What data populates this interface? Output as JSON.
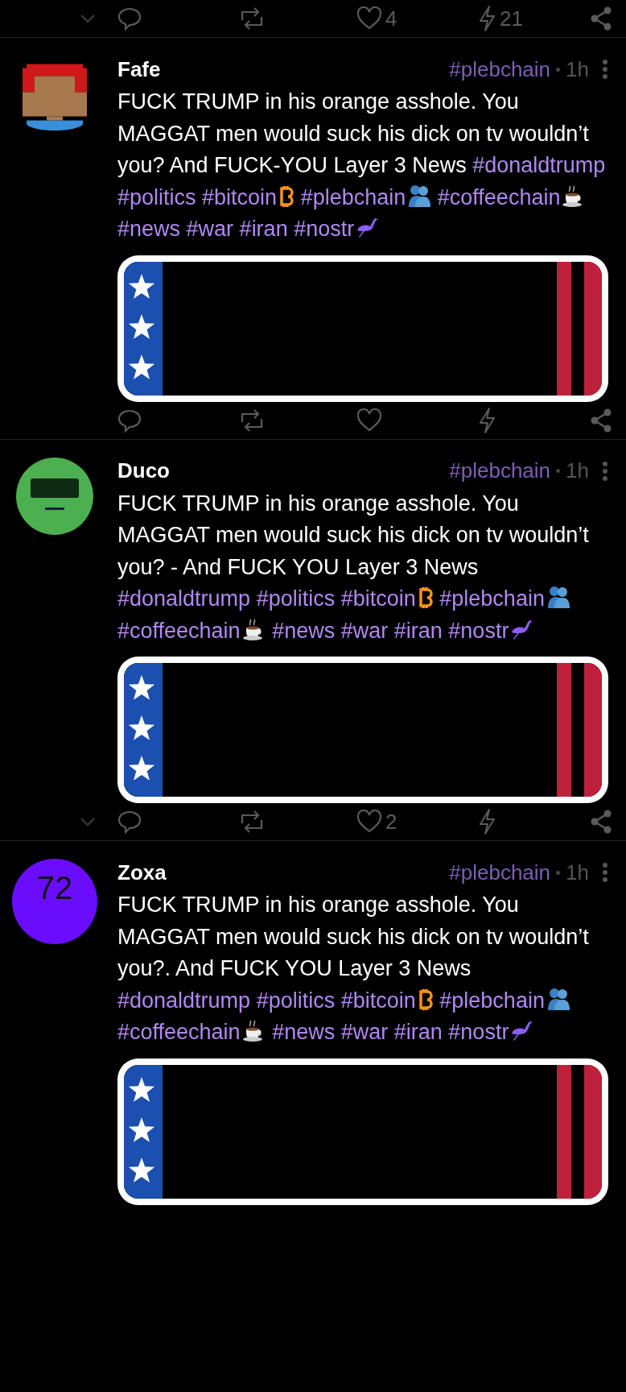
{
  "previous_post_actions": {
    "show_collapse": true,
    "likes": "4",
    "zaps": "21"
  },
  "posts": [
    {
      "author": "Fafe",
      "avatar": {
        "kind": "pixel"
      },
      "topic": "#plebchain",
      "time": "1h",
      "text": "FUCK TRUMP in his orange asshole. You MAGGAT men would suck his dick on tv wouldn’t you? And FUCK-YOU Layer 3 News",
      "tags": [
        {
          "text": "#donaldtrump",
          "kind": "plain"
        },
        {
          "text": "#politics",
          "kind": "plain"
        },
        {
          "text": "#bitcoin",
          "kind": "bitcoin"
        },
        {
          "text": "#plebchain",
          "kind": "hug"
        },
        {
          "text": "#coffeechain",
          "kind": "coffee"
        },
        {
          "text": "#news",
          "kind": "plain"
        },
        {
          "text": "#war",
          "kind": "plain"
        },
        {
          "text": "#iran",
          "kind": "plain"
        },
        {
          "text": "#nostr",
          "kind": "bird"
        }
      ],
      "actions": {
        "show_collapse": false
      }
    },
    {
      "author": "Duco",
      "avatar": {
        "kind": "robot"
      },
      "topic": "#plebchain",
      "time": "1h",
      "text": "FUCK TRUMP in his orange asshole. You MAGGAT men would suck his dick on tv wouldn’t you? - And FUCK YOU Layer 3 News",
      "tags": [
        {
          "text": "#donaldtrump",
          "kind": "plain"
        },
        {
          "text": "#politics",
          "kind": "plain"
        },
        {
          "text": "#bitcoin",
          "kind": "bitcoin"
        },
        {
          "text": "#plebchain",
          "kind": "hug"
        },
        {
          "text": "#coffeechain",
          "kind": "coffee"
        },
        {
          "text": "#news",
          "kind": "plain"
        },
        {
          "text": "#war",
          "kind": "plain"
        },
        {
          "text": "#iran",
          "kind": "plain"
        },
        {
          "text": "#nostr",
          "kind": "bird"
        }
      ],
      "actions": {
        "show_collapse": true,
        "likes": "2"
      }
    },
    {
      "author": "Zoxa",
      "avatar": {
        "kind": "initials",
        "text": "72",
        "color": "#6a0dff"
      },
      "topic": "#plebchain",
      "time": "1h",
      "text": "FUCK TRUMP in his orange asshole. You MAGGAT men would suck his dick on tv wouldn’t you?. And FUCK YOU Layer 3 News",
      "tags": [
        {
          "text": "#donaldtrump",
          "kind": "plain"
        },
        {
          "text": "#politics",
          "kind": "plain"
        },
        {
          "text": "#bitcoin",
          "kind": "bitcoin"
        },
        {
          "text": "#plebchain",
          "kind": "hug"
        },
        {
          "text": "#coffeechain",
          "kind": "coffee"
        },
        {
          "text": "#news",
          "kind": "plain"
        },
        {
          "text": "#war",
          "kind": "plain"
        },
        {
          "text": "#iran",
          "kind": "plain"
        },
        {
          "text": "#nostr",
          "kind": "bird"
        }
      ]
    }
  ]
}
